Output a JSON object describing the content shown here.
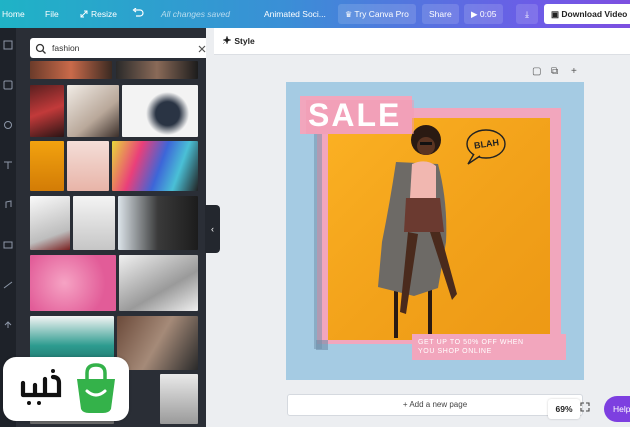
{
  "topbar": {
    "home": "Home",
    "file": "File",
    "resize": "Resize",
    "status": "All changes saved",
    "title": "Animated Soci...",
    "try_canva": "Try Canva Pro",
    "share": "Share",
    "play_time": "0:05",
    "download": "Download Video"
  },
  "search": {
    "value": "fashion"
  },
  "toolbar": {
    "style": "Style"
  },
  "design": {
    "sale": "SALE",
    "blah": "BLAH",
    "promo_line1": "GET UP TO 50% OFF WHEN",
    "promo_line2": "YOU SHOP ONLINE"
  },
  "footer": {
    "add_page": "+ Add a new page",
    "zoom": "69%",
    "help": "Help"
  },
  "colors": {
    "accent": "#7d3fe0",
    "sale_pink": "#f2a6bd",
    "design_bg": "#a5cbe3",
    "photo_orange": "#f5a623"
  }
}
